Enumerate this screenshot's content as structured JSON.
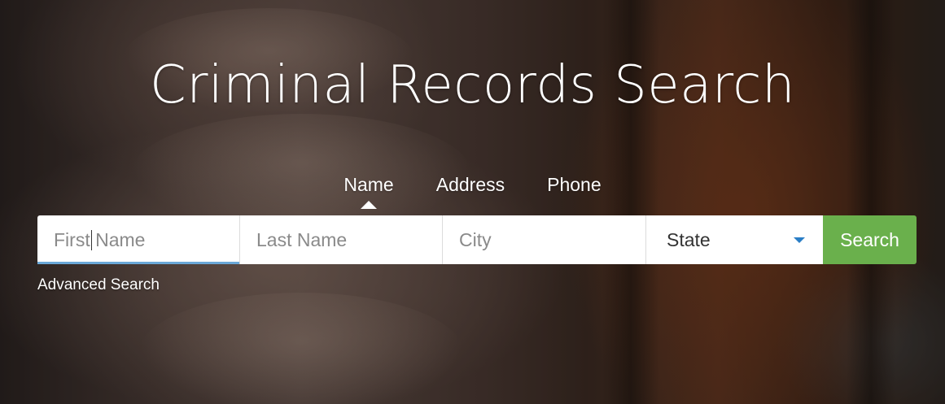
{
  "page": {
    "title": "Criminal Records Search"
  },
  "tabs": [
    {
      "label": "Name",
      "active": true
    },
    {
      "label": "Address",
      "active": false
    },
    {
      "label": "Phone",
      "active": false
    }
  ],
  "form": {
    "first_name_placeholder": "First Name",
    "last_name_placeholder": "Last Name",
    "city_placeholder": "City",
    "state_selected": "State",
    "search_label": "Search"
  },
  "links": {
    "advanced_search": "Advanced Search"
  },
  "colors": {
    "search_button": "#6ab04c",
    "focus_underline": "#6aa8d8",
    "dropdown_caret": "#2a7ec6"
  },
  "icons": {
    "state_dropdown": "chevron-down-icon"
  }
}
